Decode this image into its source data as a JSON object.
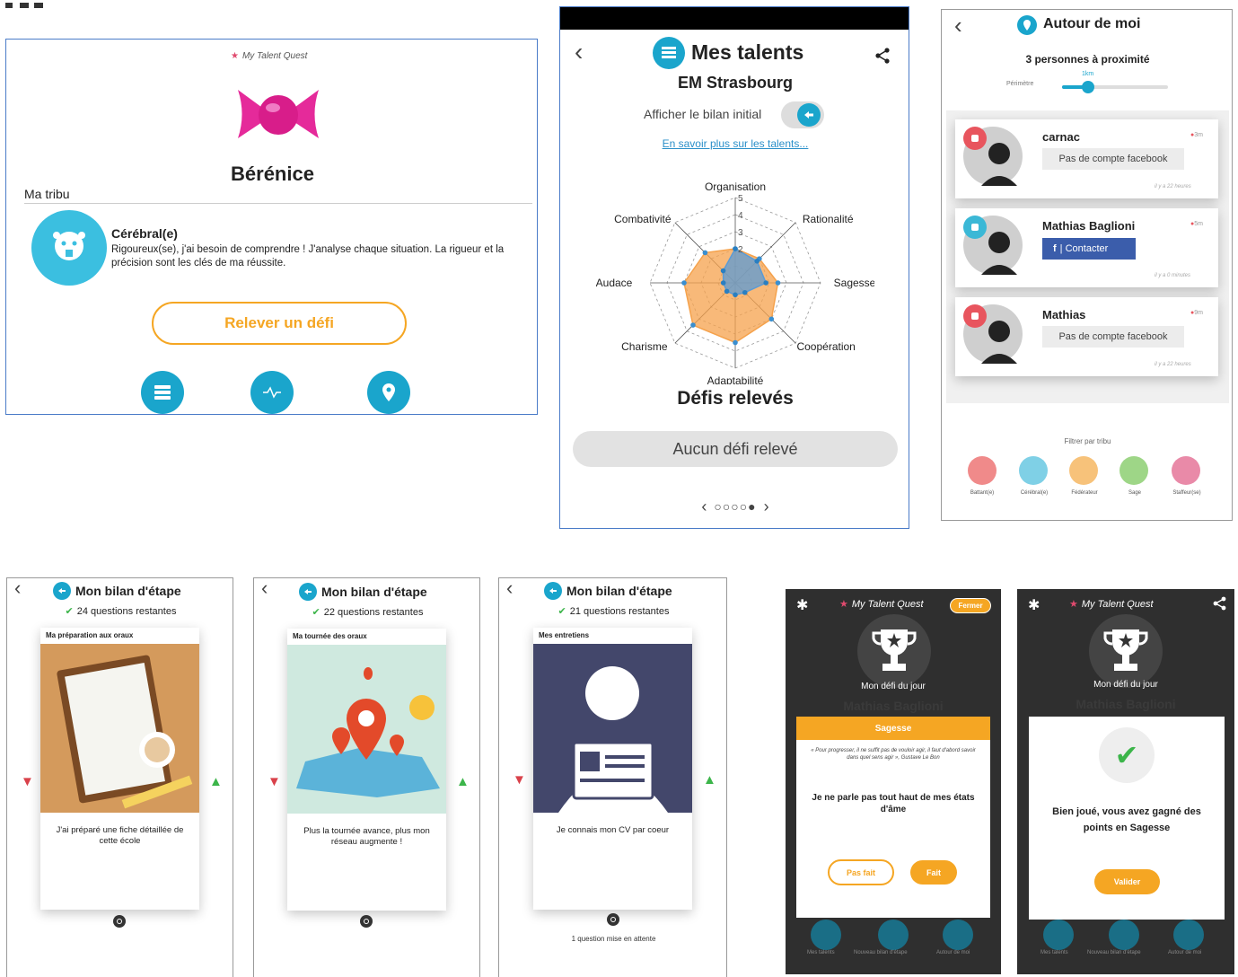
{
  "profile": {
    "logo": "My Talent Quest",
    "name": "Bérénice",
    "tribe_title": "Ma tribu",
    "tribe_name": "Cérébral(e)",
    "tribe_desc": "Rigoureux(se), j'ai besoin de comprendre ! J'analyse chaque situation. La rigueur et la précision sont les clés de ma réussite.",
    "challenge_button": "Relever un défi",
    "icons": [
      "talents-icon",
      "pulse-icon",
      "location-icon"
    ]
  },
  "talents": {
    "title": "Mes talents",
    "school": "EM Strasbourg",
    "toggle_label": "Afficher le bilan initial",
    "link": "En savoir plus sur les talents...",
    "challenges_title": "Défis relevés",
    "no_challenge": "Aucun défi relevé",
    "pager_prev": "‹",
    "pager_next": "›",
    "pager_dots": "○○○○●"
  },
  "chart_data": {
    "type": "radar",
    "categories": [
      "Organisation",
      "Rationalité",
      "Sagesse",
      "Coopération",
      "Adaptabilité",
      "Charisme",
      "Audace",
      "Combativité"
    ],
    "rmax": 5,
    "tick_labels": [
      "2",
      "3",
      "4",
      "5"
    ],
    "series": [
      {
        "values": [
          2,
          2,
          2.5,
          3,
          3.5,
          3.5,
          3,
          2.5
        ],
        "color": "#f5a24c"
      },
      {
        "values": [
          2,
          1.8,
          1.8,
          0.8,
          0.7,
          0.7,
          0.7,
          1
        ],
        "color": "#5b9bd5"
      }
    ]
  },
  "nearby": {
    "title": "Autour de moi",
    "count": "3 personnes à proximité",
    "perimeter_label": "Périmètre",
    "perimeter_value": "1km",
    "people": [
      {
        "name": "carnac",
        "distance": "3m",
        "action": "Pas de compte facebook",
        "time": "il y a 22 heures",
        "badge_color": "#e8555e"
      },
      {
        "name": "Mathias Baglioni",
        "distance": "5m",
        "action": "|  Contacter",
        "time": "il y a 0 minutes",
        "badge_color": "#3bb8d6"
      },
      {
        "name": "Mathias",
        "distance": "9m",
        "action": "Pas de compte facebook",
        "time": "il y a 22 heures",
        "badge_color": "#e8555e"
      }
    ],
    "filter_label": "Filtrer par tribu",
    "tribes": [
      {
        "label": "Battant(e)",
        "color": "#f08a8a"
      },
      {
        "label": "Cérébral(e)",
        "color": "#7fd0e6"
      },
      {
        "label": "Fédérateur",
        "color": "#f7c27a"
      },
      {
        "label": "Sage",
        "color": "#9ed687"
      },
      {
        "label": "Staffeur(se)",
        "color": "#e98aa8"
      }
    ]
  },
  "steps": [
    {
      "title": "Mon bilan d'étape",
      "remaining": "24 questions restantes",
      "card_title": "Ma préparation aux oraux",
      "text": "J'ai préparé une fiche détaillée de cette école",
      "footer": ""
    },
    {
      "title": "Mon bilan d'étape",
      "remaining": "22 questions restantes",
      "card_title": "Ma tournée des oraux",
      "text": "Plus la tournée avance, plus mon réseau augmente !",
      "footer": ""
    },
    {
      "title": "Mon bilan d'étape",
      "remaining": "21 questions restantes",
      "card_title": "Mes entretiens",
      "text": "Je connais mon CV par coeur",
      "footer": "1 question mise en attente"
    }
  ],
  "daily": {
    "logo": "My Talent Quest",
    "close": "Fermer",
    "heading": "Mon défi du jour",
    "user": "Mathias Baglioni",
    "category": "Sagesse",
    "quote": "« Pour progresser, il ne suffit pas de vouloir agir, il faut d'abord savoir dans quel sens agir », Gustave Le Bon",
    "challenge": "Je ne parle pas tout haut de mes états d'âme",
    "not_done": "Pas fait",
    "done": "Fait",
    "success": "Bien joué, vous avez gagné des points en Sagesse",
    "validate": "Valider",
    "nav": [
      "Mes talents",
      "Nouveau bilan d'étape",
      "Autour de moi"
    ]
  }
}
